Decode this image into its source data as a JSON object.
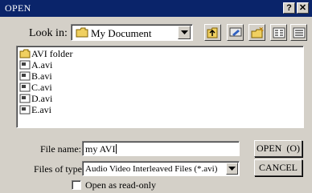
{
  "window": {
    "title": "OPEN",
    "help_glyph": "?",
    "close_glyph": "✕"
  },
  "lookin": {
    "label": "Look in:",
    "value": "My Document"
  },
  "toolbar": [
    "up-one-level-icon",
    "desktop-icon",
    "new-folder-icon",
    "list-view-icon",
    "details-view-icon"
  ],
  "files": [
    {
      "name": "AVI folder",
      "type": "folder"
    },
    {
      "name": "A.avi",
      "type": "avi"
    },
    {
      "name": "B.avi",
      "type": "avi"
    },
    {
      "name": "C.avi",
      "type": "avi"
    },
    {
      "name": "D.avi",
      "type": "avi"
    },
    {
      "name": "E.avi",
      "type": "avi"
    }
  ],
  "filename": {
    "label": "File name:",
    "value": "my AVI"
  },
  "filetype": {
    "label": "Files of type:",
    "value": "Audio Video Interleaved Files (*.avi)"
  },
  "buttons": {
    "open": "OPEN",
    "open_hotkey": "(O)",
    "cancel": "CANCEL"
  },
  "readonly": {
    "label": "Open as read-only",
    "checked": false
  }
}
